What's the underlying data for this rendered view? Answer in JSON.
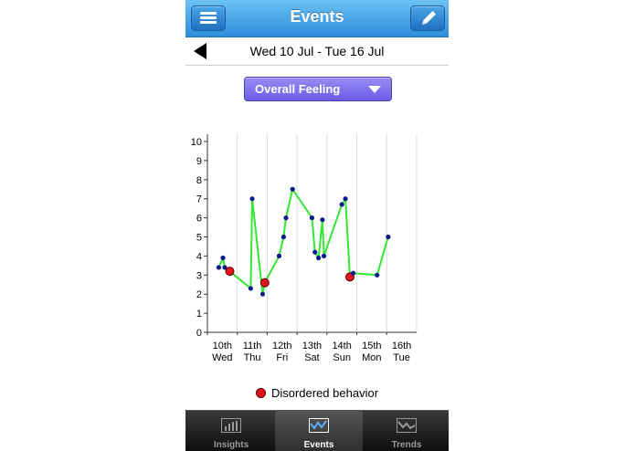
{
  "header": {
    "title": "Events",
    "menu_icon": "hamburger-menu-icon",
    "edit_icon": "pencil-icon"
  },
  "date_range": {
    "label": "Wed 10 Jul - Tue 16 Jul",
    "back_icon": "back-arrow-icon"
  },
  "dropdown": {
    "selected": "Overall Feeling"
  },
  "legend": {
    "label": "Disordered behavior",
    "color": "#e0141b"
  },
  "colors": {
    "line": "#33e833",
    "point": "#0a1a8c",
    "highlight": "#e0141b",
    "nav_blue": "#2d8ddc",
    "dropdown_purple": "#7b6cf0"
  },
  "chart_data": {
    "type": "line",
    "ylim": [
      0,
      10
    ],
    "yticks": [
      "0",
      "1",
      "2",
      "3",
      "4",
      "5",
      "6",
      "7",
      "8",
      "9",
      "10"
    ],
    "categories": [
      {
        "day": "10th",
        "weekday": "Wed"
      },
      {
        "day": "11th",
        "weekday": "Thu"
      },
      {
        "day": "12th",
        "weekday": "Fri"
      },
      {
        "day": "13th",
        "weekday": "Sat"
      },
      {
        "day": "14th",
        "weekday": "Sun"
      },
      {
        "day": "15th",
        "weekday": "Mon"
      },
      {
        "day": "16th",
        "weekday": "Tue"
      }
    ],
    "series": [
      {
        "points": [
          {
            "x": 0.38,
            "y": 3.4
          },
          {
            "x": 0.52,
            "y": 3.9
          },
          {
            "x": 0.58,
            "y": 3.4
          },
          {
            "x": 0.75,
            "y": 3.2,
            "highlight": true
          },
          {
            "x": 1.45,
            "y": 2.3
          },
          {
            "x": 1.5,
            "y": 7.0
          },
          {
            "x": 1.85,
            "y": 2.0
          },
          {
            "x": 1.92,
            "y": 2.6,
            "highlight": true
          },
          {
            "x": 2.4,
            "y": 4.0
          },
          {
            "x": 2.55,
            "y": 5.0
          },
          {
            "x": 2.63,
            "y": 6.0
          },
          {
            "x": 2.85,
            "y": 7.5
          },
          {
            "x": 3.5,
            "y": 6.0
          },
          {
            "x": 3.6,
            "y": 4.2
          },
          {
            "x": 3.72,
            "y": 3.9
          },
          {
            "x": 3.85,
            "y": 5.9
          },
          {
            "x": 3.9,
            "y": 4.0
          },
          {
            "x": 4.5,
            "y": 6.7
          },
          {
            "x": 4.62,
            "y": 7.0
          },
          {
            "x": 4.77,
            "y": 2.9,
            "highlight": true
          },
          {
            "x": 4.88,
            "y": 3.1
          },
          {
            "x": 5.68,
            "y": 3.0
          },
          {
            "x": 6.05,
            "y": 5.0
          }
        ]
      }
    ]
  },
  "tabs": [
    {
      "label": "Insights",
      "icon": "bar-chart-icon",
      "selected": false
    },
    {
      "label": "Events",
      "icon": "line-chart-icon",
      "selected": true
    },
    {
      "label": "Trends",
      "icon": "trend-chart-icon",
      "selected": false
    }
  ]
}
